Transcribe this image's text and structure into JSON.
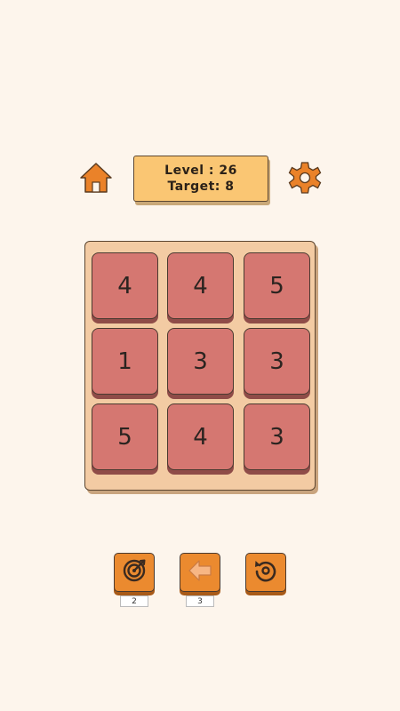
{
  "header": {
    "level_text": "Level : 26",
    "target_text": "Target: 8",
    "home_icon": "home-icon",
    "settings_icon": "gear-icon"
  },
  "board": {
    "rows": [
      [
        "4",
        "4",
        "5"
      ],
      [
        "1",
        "3",
        "3"
      ],
      [
        "5",
        "4",
        "3"
      ]
    ]
  },
  "tools": {
    "hint": {
      "icon": "target-icon",
      "count": "2"
    },
    "undo": {
      "icon": "back-arrow-icon",
      "count": "3"
    },
    "restart": {
      "icon": "restart-icon"
    }
  },
  "colors": {
    "background": "#fdf5ec",
    "accent_orange": "#eb8a2f",
    "panel_yellow": "#fac673",
    "board": "#f3cba3",
    "tile": "#d57771"
  }
}
